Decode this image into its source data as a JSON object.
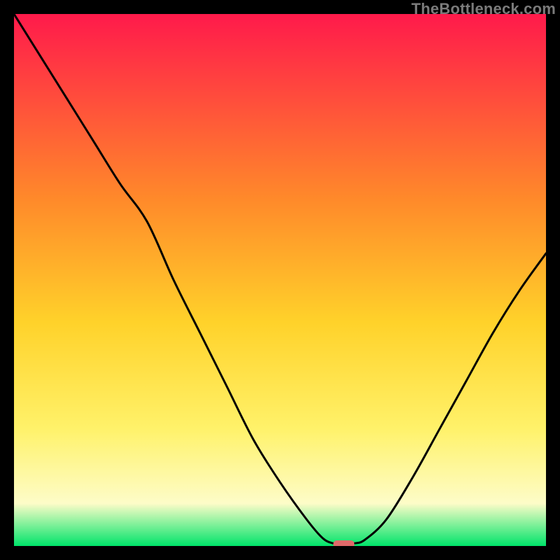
{
  "attribution": "TheBottleneck.com",
  "colors": {
    "gradient_top": "#ff1a4b",
    "gradient_upper_mid": "#ff8a2a",
    "gradient_mid": "#ffd22a",
    "gradient_lower_mid": "#fff26a",
    "gradient_pale": "#fdfcc8",
    "gradient_bottom": "#00e46a",
    "curve": "#000000",
    "marker": "#e06a6a",
    "frame": "#000000"
  },
  "chart_data": {
    "type": "line",
    "title": "",
    "xlabel": "",
    "ylabel": "",
    "xlim": [
      0,
      100
    ],
    "ylim": [
      0,
      100
    ],
    "x": [
      0,
      5,
      10,
      15,
      20,
      25,
      30,
      35,
      40,
      45,
      50,
      55,
      58,
      60,
      62,
      64,
      66,
      70,
      75,
      80,
      85,
      90,
      95,
      100
    ],
    "values": [
      100,
      92,
      84,
      76,
      68,
      61,
      50,
      40,
      30,
      20,
      12,
      5,
      1.5,
      0.5,
      0.4,
      0.5,
      1.2,
      5,
      13,
      22,
      31,
      40,
      48,
      55
    ],
    "marker": {
      "x": 62,
      "y": 0.4
    },
    "notes": "Gradient background running from red (high bottleneck) through orange/yellow to green (no bottleneck). Black V-shaped curve showing bottleneck percentage vs. an unlabeled x-axis value; minimum near x≈62. Small rounded pink marker at the minimum. Axes carry no tick labels."
  }
}
